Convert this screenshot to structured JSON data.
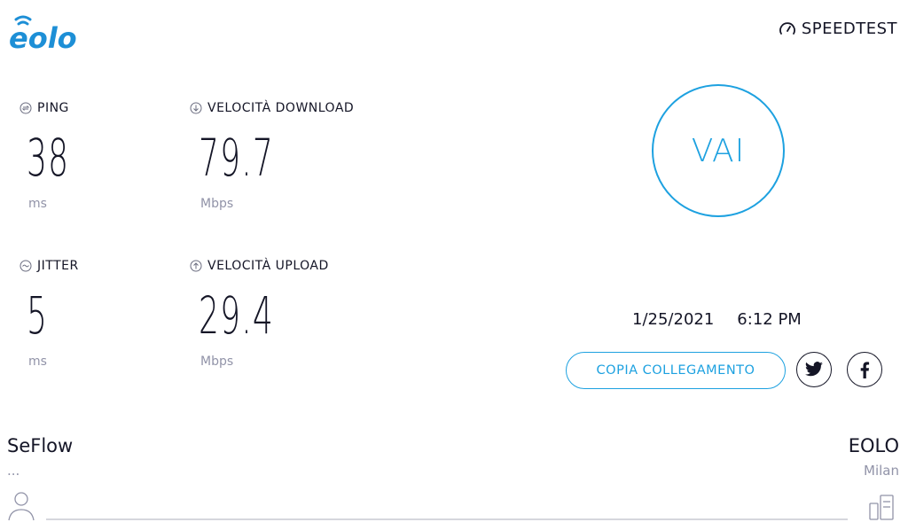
{
  "brand": {
    "logo": "eolo",
    "accent": "#1da1e0",
    "logo_color": "#1d8fd6"
  },
  "speedtest": {
    "label": "SPEEDTEST",
    "icon": "gauge-icon"
  },
  "metrics": {
    "ping": {
      "label": "PING",
      "value": "38",
      "unit": "ms",
      "icon": "ping-icon"
    },
    "download": {
      "label": "VELOCITÀ DOWNLOAD",
      "value": "79.7",
      "unit": "Mbps",
      "icon": "arrow-down-circle-icon"
    },
    "jitter": {
      "label": "JITTER",
      "value": "5",
      "unit": "ms",
      "icon": "wave-circle-icon"
    },
    "upload": {
      "label": "VELOCITÀ UPLOAD",
      "value": "29.4",
      "unit": "Mbps",
      "icon": "arrow-up-circle-icon"
    }
  },
  "go_button": {
    "label": "VAI"
  },
  "result": {
    "date": "1/25/2021",
    "time": "6:12 PM"
  },
  "share": {
    "copy_label": "COPIA COLLEGAMENTO",
    "twitter_icon": "twitter-icon",
    "facebook_icon": "facebook-icon"
  },
  "client": {
    "name": "SeFlow",
    "sub": "...",
    "icon": "user-icon"
  },
  "server": {
    "name": "EOLO",
    "location": "Milan",
    "icon": "server-icon"
  }
}
